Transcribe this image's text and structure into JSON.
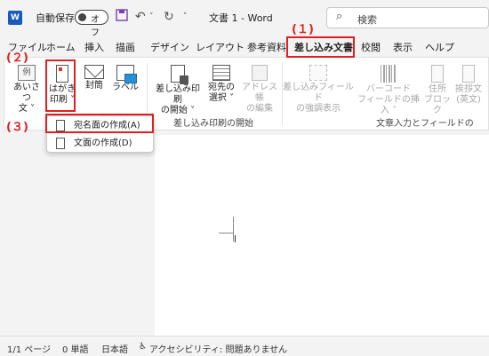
{
  "titlebar": {
    "app_icon": "W",
    "autosave_label": "自動保存",
    "autosave_state": "オフ",
    "document_title": "文書 1 - Word",
    "search_placeholder": "検索"
  },
  "tabs": [
    {
      "label": "ファイル"
    },
    {
      "label": "ホーム"
    },
    {
      "label": "挿入"
    },
    {
      "label": "描画"
    },
    {
      "label": "デザイン"
    },
    {
      "label": "レイアウト"
    },
    {
      "label": "参考資料"
    },
    {
      "label": "差し込み文書",
      "active": true
    },
    {
      "label": "校閲"
    },
    {
      "label": "表示"
    },
    {
      "label": "ヘルプ"
    }
  ],
  "ribbon": {
    "aisatsu_icon": "例",
    "aisatsu_line1": "あいさつ",
    "aisatsu_line2": "文 ˅",
    "hagaki_line1": "はがき",
    "hagaki_line2": "印刷 ˅",
    "futo": "封筒",
    "label": "ラベル",
    "sashikomi_start_line1": "差し込み印刷",
    "sashikomi_start_line2": "の開始 ˅",
    "atesaki_line1": "宛先の",
    "atesaki_line2": "選択 ˅",
    "addressbook_line1": "アドレス帳",
    "addressbook_line2": "の編集",
    "group_start": "差し込み印刷の開始",
    "highlight_line1": "差し込みフィールド",
    "highlight_line2": "の強調表示",
    "barcode_line1": "バーコード",
    "barcode_line2": "フィールドの挿入 ˅",
    "address_line1": "住所",
    "address_line2": "ブロック",
    "greeting_line1": "挨拶文",
    "greeting_line2": "(英文)",
    "group_fields": "文章入力とフィールドの"
  },
  "dropdown": {
    "item1": "宛名面の作成(A)",
    "item2": "文面の作成(D)"
  },
  "annotations": {
    "a1": "(１)",
    "a2": "(２)",
    "a3": "(３)"
  },
  "statusbar": {
    "page": "1/1 ページ",
    "words": "0 単語",
    "language": "日本語",
    "accessibility": "アクセシビリティ: 問題ありません"
  },
  "colors": {
    "accent": "#185abd",
    "annotation": "#e02020"
  }
}
